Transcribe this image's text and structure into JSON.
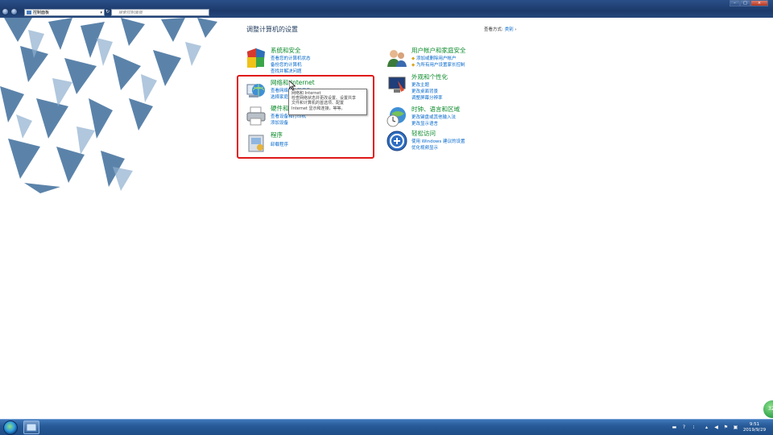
{
  "window": {
    "address": "控制面板",
    "search_placeholder": "搜索控制面板",
    "controls": [
      "–",
      "□",
      "×"
    ]
  },
  "page": {
    "header": "调整计算机的设置",
    "view_by_label": "查看方式:",
    "view_by_value": "类别"
  },
  "categories_left": [
    {
      "title": "系统和安全",
      "icon": "shield-icon",
      "links": [
        "查看您的计算机状态",
        "备份您的计算机",
        "查找并解决问题"
      ]
    },
    {
      "title": "网络和 Internet",
      "icon": "network-globe-icon",
      "links": [
        "查看网络状态和任务",
        "选择家庭组和共享选项"
      ]
    },
    {
      "title": "硬件和声音",
      "icon": "printer-icon",
      "links": [
        "查看设备和打印机",
        "添加设备"
      ]
    },
    {
      "title": "程序",
      "icon": "programs-icon",
      "links": [
        "卸载程序"
      ]
    }
  ],
  "categories_right": [
    {
      "title": "用户帐户和家庭安全",
      "icon": "users-icon",
      "links": [
        "添加或删除用户帐户",
        "为所有用户设置家长控制"
      ]
    },
    {
      "title": "外观和个性化",
      "icon": "monitor-paint-icon",
      "links": [
        "更改主题",
        "更改桌面背景",
        "调整屏幕分辨率"
      ]
    },
    {
      "title": "时钟、语言和区域",
      "icon": "clock-globe-icon",
      "links": [
        "更改键盘或其他输入法",
        "更改显示语言"
      ]
    },
    {
      "title": "轻松访问",
      "icon": "ease-of-access-icon",
      "links": [
        "使用 Windows 建议的设置",
        "优化视频显示"
      ]
    }
  ],
  "tooltip": {
    "title": "网络和 Internet",
    "body": [
      "检查网络状态并更改设置、设置共享",
      "文件和计算机的首选项、配置",
      "Internet 显示和连接，等等。"
    ]
  },
  "taskbar": {
    "clock_time": "9:51",
    "clock_date": "2019/9/29",
    "tray_badge": "32"
  },
  "colors": {
    "category_title": "#0a8a2a",
    "link": "#0066cc",
    "highlight_box": "#e01818"
  }
}
